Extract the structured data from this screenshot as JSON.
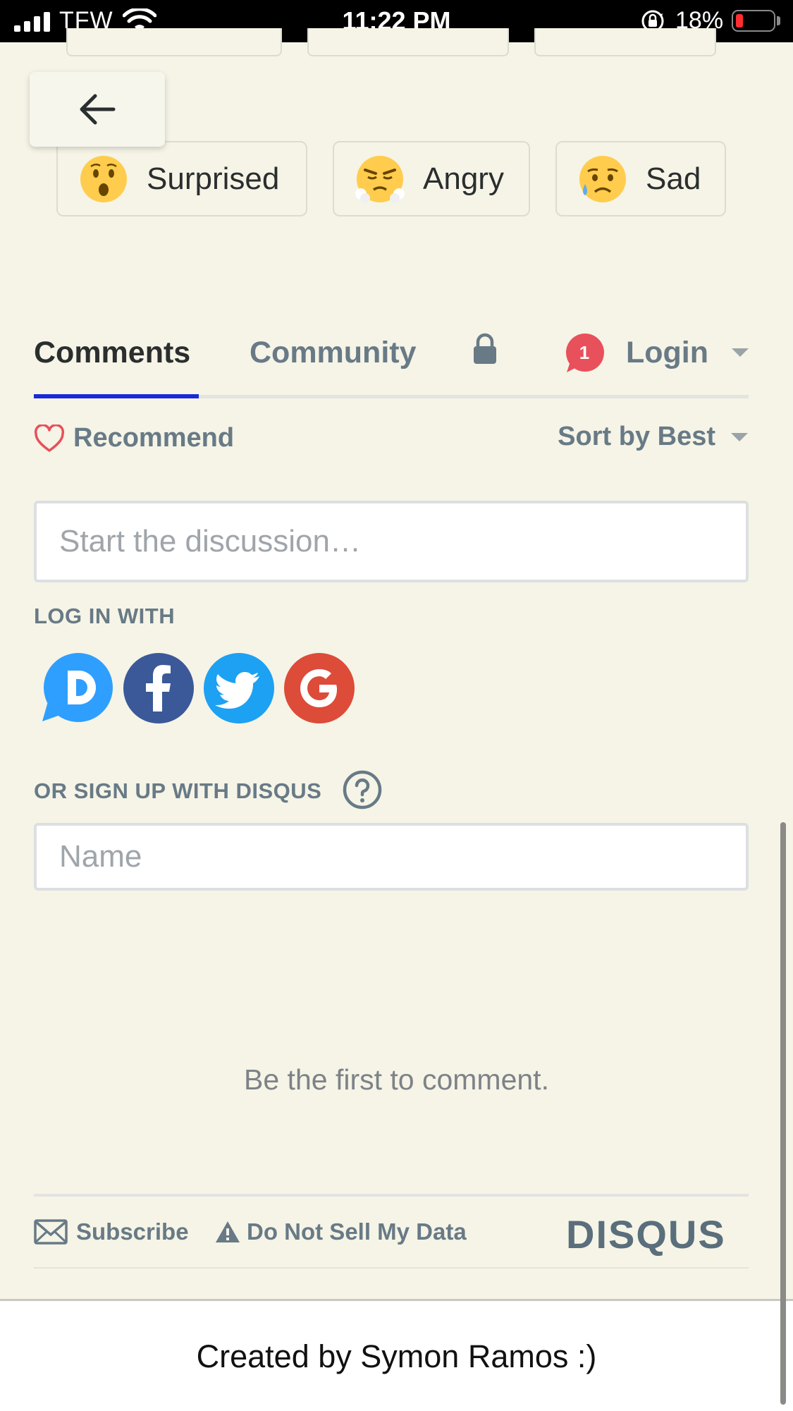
{
  "status_bar": {
    "carrier": "TFW",
    "time": "11:22 PM",
    "battery_percent": "18%",
    "battery_level": 0.18,
    "battery_color": "#ff2d2d"
  },
  "reactions": [
    {
      "label": "Surprised",
      "icon": "surprised-face-icon"
    },
    {
      "label": "Angry",
      "icon": "angry-face-icon"
    },
    {
      "label": "Sad",
      "icon": "sad-face-icon"
    }
  ],
  "tabs": {
    "comments": "Comments",
    "community": "Community",
    "notification_count": "1",
    "login": "Login"
  },
  "actions": {
    "recommend": "Recommend",
    "sort": "Sort by Best"
  },
  "discussion": {
    "placeholder": "Start the discussion…"
  },
  "login_with": {
    "label": "LOG IN WITH",
    "providers": [
      "disqus-icon",
      "facebook-icon",
      "twitter-icon",
      "google-icon"
    ]
  },
  "signup": {
    "label": "OR SIGN UP WITH DISQUS",
    "name_placeholder": "Name"
  },
  "empty_message": "Be the first to comment.",
  "footer": {
    "subscribe": "Subscribe",
    "do_not_sell": "Do Not Sell My Data",
    "brand": "DISQUS"
  },
  "credit": "Created by Symon Ramos :)",
  "colors": {
    "background": "#f5f4e6",
    "tab_active_underline": "#1a28d8",
    "muted_text": "#687a86",
    "disqus_blue": "#2e9fff",
    "facebook_blue": "#3b5998",
    "twitter_blue": "#1da1f2",
    "google_red": "#dd4b39",
    "badge_red": "#e8505b"
  }
}
